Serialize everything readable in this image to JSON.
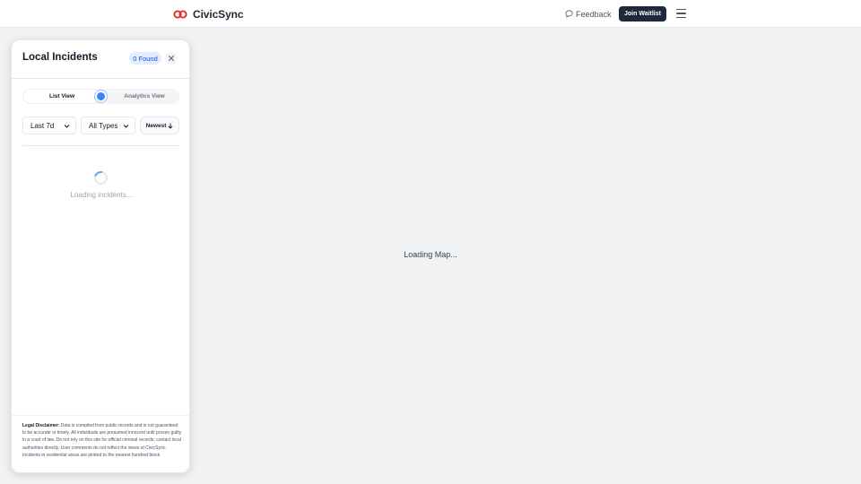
{
  "header": {
    "brand_name": "CivicSync",
    "feedback_label": "Feedback",
    "join_button_label": "Join Waitlist",
    "accent": "#1e293b",
    "logo_color": "#dc2626"
  },
  "map": {
    "loading_text": "Loading Map..."
  },
  "panel": {
    "title": "Local Incidents",
    "found_badge": "0 Found",
    "view_toggle": {
      "list_label": "List View",
      "analytics_label": "Analytics View",
      "selected": "List View"
    },
    "filters": {
      "time_range": "Last 7d",
      "type": "All Types",
      "sort_label": "Newest"
    },
    "loading_text": "Loading incidents...",
    "disclaimer": {
      "label": "Legal Disclaimer:",
      "text": "Data is compiled from public records and is not guaranteed to be accurate or timely.  All individuals are presumed innocent until proven guilty in a court of law. Do not rely on this site for official criminal records; contact local authorities directly. User comments do not reflect the views of CivicSync. Incidents in residential areas are plotted to the nearest hundred block."
    }
  },
  "icons": {
    "logo": "linked-rings-logo",
    "feedback": "speech-bubble-icon",
    "menu": "hamburger-menu-icon",
    "close": "close-icon",
    "dropdown": "chevron-down-icon",
    "sort": "arrow-down-icon"
  }
}
